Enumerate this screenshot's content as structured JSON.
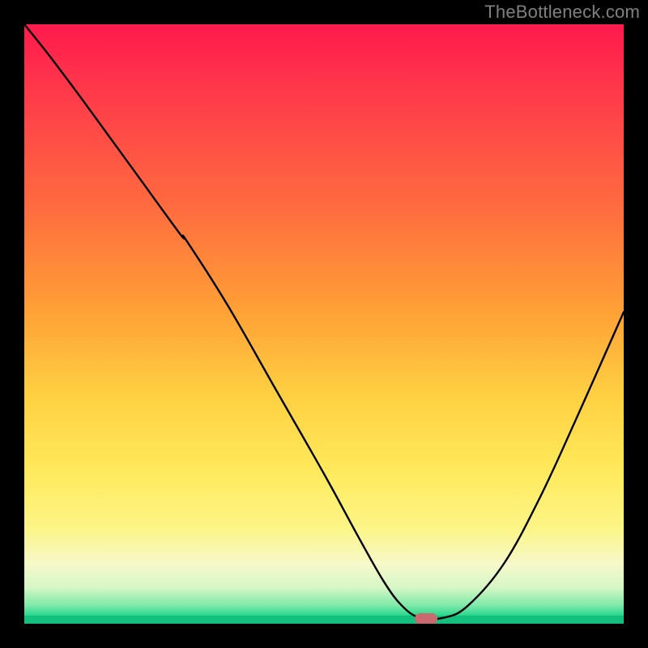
{
  "watermark": "TheBottleneck.com",
  "chart_data": {
    "type": "line",
    "title": "",
    "xlabel": "",
    "ylabel": "",
    "xlim": [
      0,
      100
    ],
    "ylim": [
      0,
      100
    ],
    "grid": false,
    "x": [
      0,
      4,
      10,
      18,
      26,
      27,
      34,
      42,
      50,
      56,
      60,
      63,
      66,
      70,
      74,
      80,
      86,
      92,
      100
    ],
    "values": [
      100,
      95,
      87,
      76,
      65,
      64,
      53,
      39,
      25,
      14,
      7,
      3,
      1,
      1,
      3,
      10,
      21,
      34,
      52
    ],
    "marker": {
      "x": 67,
      "y": 0.8
    },
    "background": "vertical-gradient-red-to-green"
  }
}
